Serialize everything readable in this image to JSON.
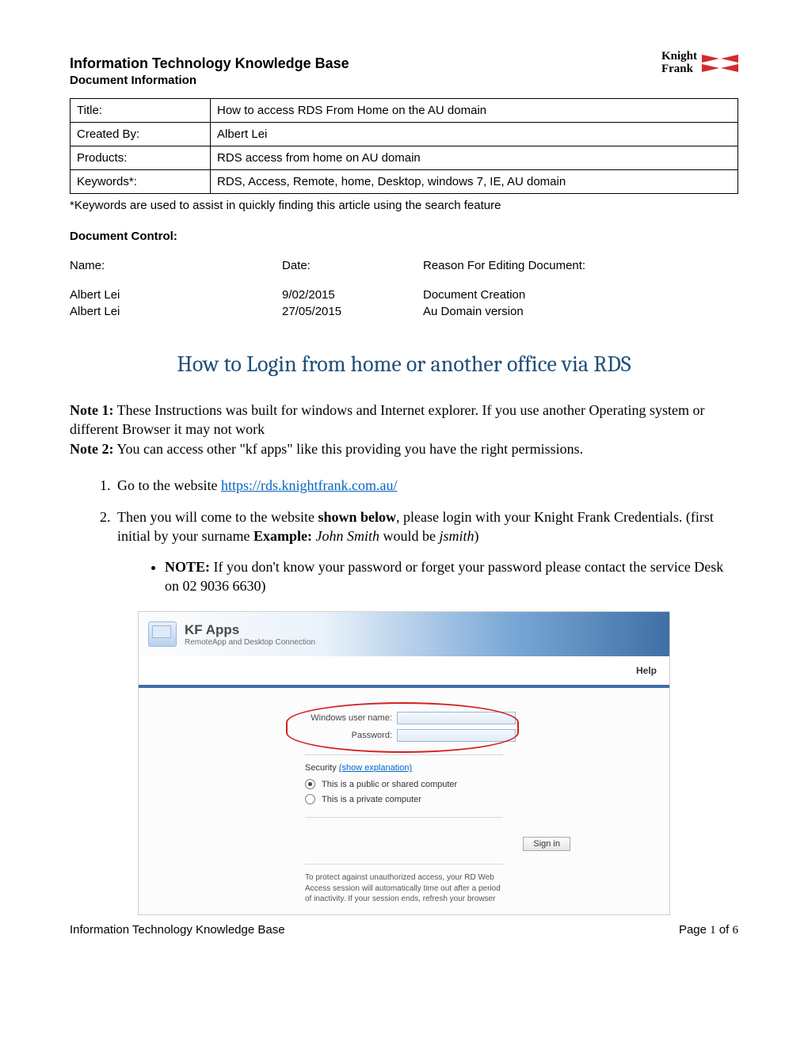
{
  "header": {
    "title": "Information Technology Knowledge Base",
    "subtitle": "Document Information",
    "logo_line1": "Knight",
    "logo_line2": "Frank"
  },
  "info_table": {
    "rows": [
      {
        "label": "Title:",
        "value": "How to access RDS From Home on the AU domain"
      },
      {
        "label": "Created By:",
        "value": "Albert Lei"
      },
      {
        "label": "Products:",
        "value": "RDS access from home on AU domain"
      },
      {
        "label": "Keywords*:",
        "value": "RDS, Access, Remote, home, Desktop, windows 7, IE, AU domain"
      }
    ],
    "footnote": "*Keywords are used to assist in quickly finding this article using the search feature"
  },
  "doc_control": {
    "heading": "Document Control:",
    "headers": {
      "name": "Name:",
      "date": "Date:",
      "reason": "Reason For Editing Document:"
    },
    "rows": [
      {
        "name": "Albert Lei",
        "date": "9/02/2015",
        "reason": "Document Creation"
      },
      {
        "name": "Albert Lei",
        "date": "27/05/2015",
        "reason": "Au Domain version"
      }
    ]
  },
  "main_title": "How to Login from home or another office via RDS",
  "notes": {
    "n1_label": "Note 1:",
    "n1_text": " These Instructions was built for windows and Internet explorer. If you use another Operating system or different Browser it may not work",
    "n2_label": "Note 2:",
    "n2_text": " You can access other \"kf apps\" like this providing you have the right permissions."
  },
  "steps": {
    "s1_pre": "Go to the website ",
    "s1_link": "https://rds.knightfrank.com.au/",
    "s2_a": "Then you will come to the website ",
    "s2_b": "shown below",
    "s2_c": ", please login with your Knight Frank Credentials.  (first initial by your surname ",
    "s2_d": "Example:",
    "s2_e": " John Smith",
    "s2_f": " would be ",
    "s2_g": "jsmith",
    "s2_h": ")",
    "sub_label": "NOTE:",
    "sub_text": " If you don't know your password or forget your password please contact the service Desk on 02 9036 6630)"
  },
  "kf": {
    "app_title": "KF Apps",
    "app_sub": "RemoteApp and Desktop Connection",
    "help": "Help",
    "username_label": "Windows user name:",
    "password_label": "Password:",
    "security_pre": "Security ",
    "security_link": "(show explanation)",
    "radio_public": "This is a public or shared computer",
    "radio_private": "This is a private computer",
    "signin": "Sign in",
    "footnote": "To protect against unauthorized access, your RD Web Access session will automatically time out after a period of inactivity. If your session ends, refresh your browser"
  },
  "footer": {
    "left": "Information Technology Knowledge Base",
    "right_pre": "Page ",
    "right_num": "1",
    "right_mid": " of ",
    "right_total": "6"
  }
}
